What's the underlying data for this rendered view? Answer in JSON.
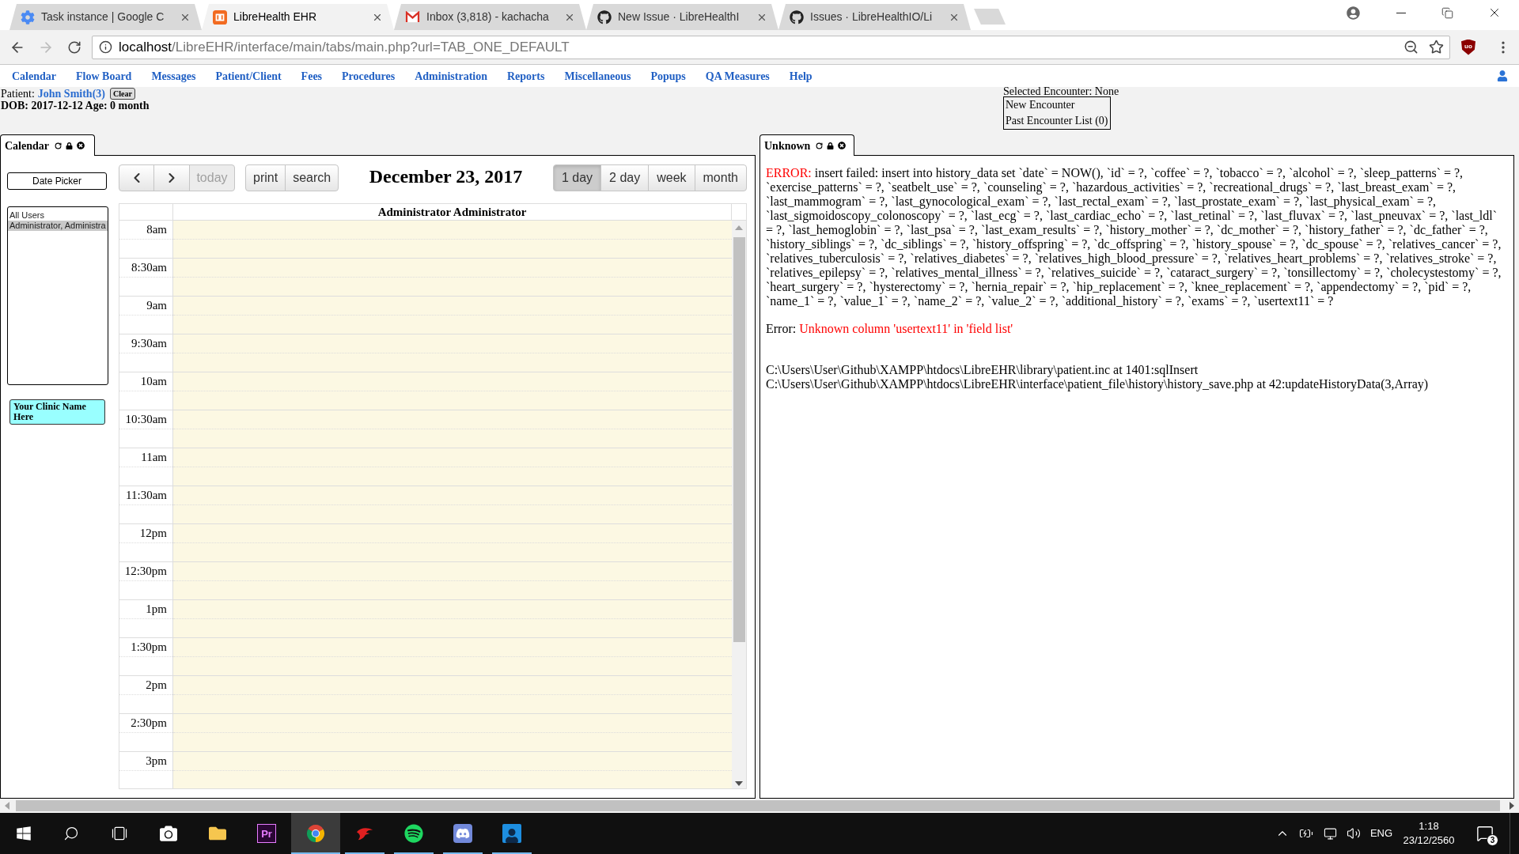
{
  "browser": {
    "tabs": [
      {
        "kind": "gear",
        "title": "Task instance | Google C",
        "selected": false
      },
      {
        "kind": "ehr",
        "title": "LibreHealth EHR",
        "selected": true
      },
      {
        "kind": "mail",
        "title": "Inbox (3,818) - kachacha",
        "selected": false
      },
      {
        "kind": "github",
        "title": "New Issue · LibreHealthI",
        "selected": false
      },
      {
        "kind": "github",
        "title": "Issues · LibreHealthIO/Li",
        "selected": false
      }
    ],
    "nav": {
      "back_disabled": false,
      "forward_disabled": true
    },
    "address": {
      "host": "localhost",
      "path": "/LibreEHR/interface/main/tabs/main.php?url=TAB_ONE_DEFAULT"
    },
    "extension": "uo"
  },
  "menu": [
    "Calendar",
    "Flow Board",
    "Messages",
    "Patient/Client",
    "Fees",
    "Procedures",
    "Administration",
    "Reports",
    "Miscellaneous",
    "Popups",
    "QA Measures",
    "Help"
  ],
  "patient": {
    "label": "Patient:",
    "name": "John Smith(3)",
    "clear": "Clear",
    "details": "DOB: 2017-12-12 Age: 0 month"
  },
  "encounter": {
    "status": "Selected Encounter: None",
    "options": [
      "New Encounter",
      "Past Encounter List (0)"
    ]
  },
  "calendar_panel": {
    "title": "Calendar",
    "date_picker": "Date Picker",
    "users": [
      {
        "label": "All Users",
        "selected": false
      },
      {
        "label": "Administrator, Administra",
        "selected": true
      }
    ],
    "clinic": "Your Clinic Name Here",
    "nav": [
      {
        "kind": "prev",
        "disabled": false
      },
      {
        "kind": "next",
        "disabled": false
      },
      {
        "kind": "text",
        "label": "today",
        "disabled": true
      }
    ],
    "actions": [
      "print",
      "search"
    ],
    "date": "December 23, 2017",
    "views": [
      {
        "label": "1 day",
        "selected": true
      },
      {
        "label": "2 day",
        "selected": false
      },
      {
        "label": "week",
        "selected": false
      },
      {
        "label": "month",
        "selected": false
      }
    ],
    "provider": "Administrator Administrator",
    "times": [
      "8am",
      "8:30am",
      "9am",
      "9:30am",
      "10am",
      "10:30am",
      "11am",
      "11:30am",
      "12pm",
      "12:30pm",
      "1pm",
      "1:30pm",
      "2pm",
      "2:30pm",
      "3pm"
    ]
  },
  "error_panel": {
    "title": "Unknown",
    "error_label": "ERROR:",
    "error_text": "insert failed: insert into history_data set `date` = NOW(), `id` = ?, `coffee` = ?, `tobacco` = ?, `alcohol` = ?, `sleep_patterns` = ?, `exercise_patterns` = ?, `seatbelt_use` = ?, `counseling` = ?, `hazardous_activities` = ?, `recreational_drugs` = ?, `last_breast_exam` = ?, `last_mammogram` = ?, `last_gynocological_exam` = ?, `last_rectal_exam` = ?, `last_prostate_exam` = ?, `last_physical_exam` = ?, `last_sigmoidoscopy_colonoscopy` = ?, `last_ecg` = ?, `last_cardiac_echo` = ?, `last_retinal` = ?, `last_fluvax` = ?, `last_pneuvax` = ?, `last_ldl` = ?, `last_hemoglobin` = ?, `last_psa` = ?, `last_exam_results` = ?, `history_mother` = ?, `dc_mother` = ?, `history_father` = ?, `dc_father` = ?, `history_siblings` = ?, `dc_siblings` = ?, `history_offspring` = ?, `dc_offspring` = ?, `history_spouse` = ?, `dc_spouse` = ?, `relatives_cancer` = ?, `relatives_tuberculosis` = ?, `relatives_diabetes` = ?, `relatives_high_blood_pressure` = ?, `relatives_heart_problems` = ?, `relatives_stroke` = ?, `relatives_epilepsy` = ?, `relatives_mental_illness` = ?, `relatives_suicide` = ?, `cataract_surgery` = ?, `tonsillectomy` = ?, `cholecystestomy` = ?, `heart_surgery` = ?, `hysterectomy` = ?, `hernia_repair` = ?, `hip_replacement` = ?, `knee_replacement` = ?, `appendectomy` = ?, `pid` = ?, `name_1` = ?, `value_1` = ?, `name_2` = ?, `value_2` = ?, `additional_history` = ?, `exams` = ?, `usertext11` = ?",
    "detail_label": "Error:",
    "detail_text": "Unknown column 'usertext11' in 'field list'",
    "trace": [
      "C:\\Users\\User\\Github\\XAMPP\\htdocs\\LibreEHR\\library\\patient.inc at 1401:sqlInsert",
      "C:\\Users\\User\\Github\\XAMPP\\htdocs\\LibreEHR\\interface\\patient_file\\history\\history_save.php at 42:updateHistoryData(3,Array)"
    ]
  },
  "taskbar": {
    "apps": [
      {
        "kind": "camera",
        "running": false,
        "selected": false
      },
      {
        "kind": "folder",
        "running": false,
        "selected": false
      },
      {
        "kind": "premiere",
        "label": "Pr",
        "running": false,
        "selected": false
      },
      {
        "kind": "browser",
        "running": true,
        "selected": true
      },
      {
        "kind": "bird",
        "running": true,
        "selected": false
      },
      {
        "kind": "music",
        "running": true,
        "selected": false
      },
      {
        "kind": "chat",
        "running": true,
        "selected": false
      },
      {
        "kind": "person",
        "running": true,
        "selected": false
      }
    ],
    "language": "ENG",
    "time": "1:18",
    "date": "23/12/2560",
    "notifications": "3"
  }
}
